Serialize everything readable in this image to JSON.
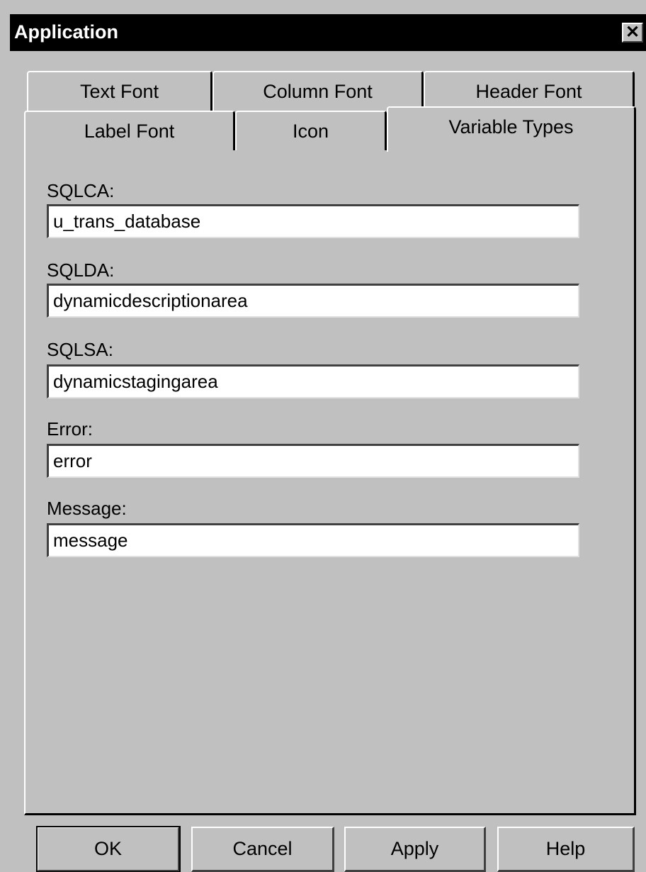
{
  "window": {
    "title": "Application",
    "close_symbol": "✕"
  },
  "tabs": {
    "row1": [
      "Text Font",
      "Column Font",
      "Header Font"
    ],
    "row2": [
      "Label Font",
      "Icon"
    ],
    "active": "Variable Types"
  },
  "fields": [
    {
      "label": "SQLCA:",
      "value": "u_trans_database"
    },
    {
      "label": "SQLDA:",
      "value": "dynamicdescriptionarea"
    },
    {
      "label": "SQLSA:",
      "value": "dynamicstagingarea"
    },
    {
      "label": "Error:",
      "value": "error"
    },
    {
      "label": "Message:",
      "value": "message"
    }
  ],
  "buttons": {
    "ok": "OK",
    "cancel": "Cancel",
    "apply": "Apply",
    "help": "Help"
  },
  "icons": {
    "close": "close-icon"
  }
}
